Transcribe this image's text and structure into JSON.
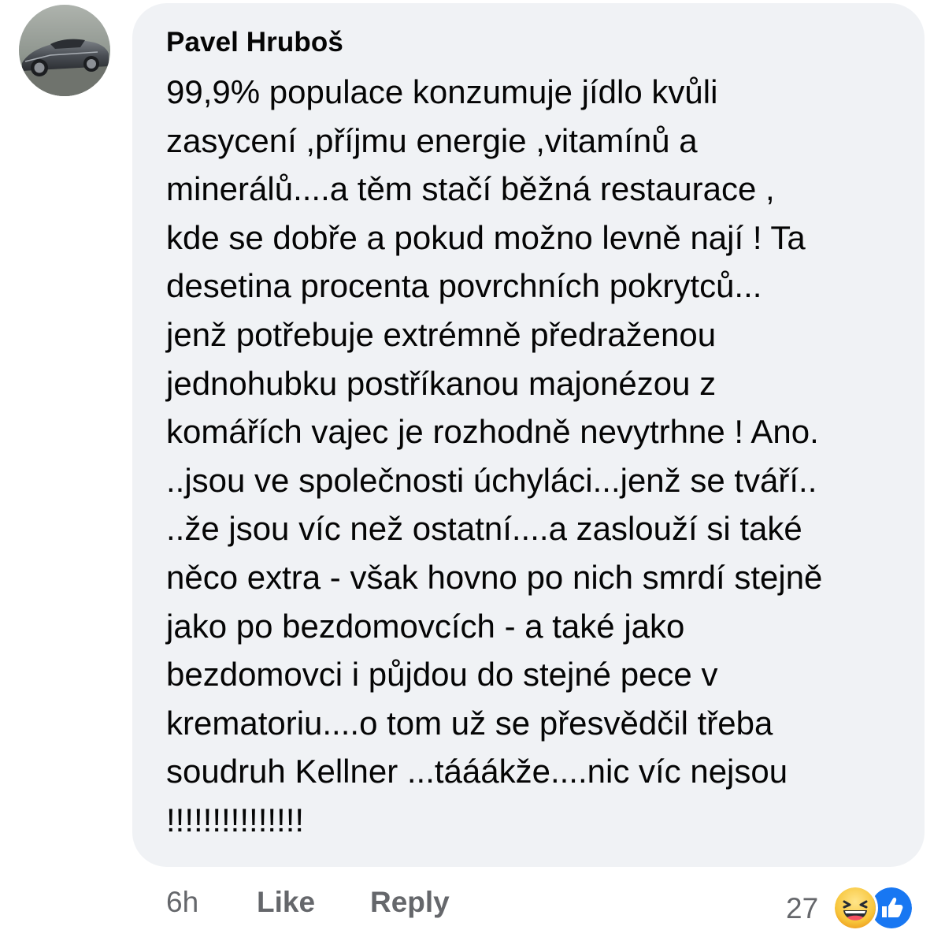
{
  "comment": {
    "author": "Pavel Hruboš",
    "text_lines": [
      "99,9% populace konzumuje jídlo kvůli",
      "zasycení ,příjmu energie ,vitamínů a",
      "minerálů....a těm stačí běžná restaurace ,",
      "kde se dobře a pokud možno levně nají ! Ta",
      "desetina procenta povrchních pokrytců...",
      "jenž potřebuje extrémně předraženou",
      "jednohubku postříkanou majonézou z",
      "komářích vajec je rozhodně nevytrhne ! Ano.",
      "..jsou ve společnosti úchyláci...jenž se tváří..",
      "..že jsou víc než ostatní....a zaslouží si také",
      "něco extra - však hovno po nich smrdí stejně",
      "jako po bezdomovcích - a také jako",
      "bezdomovci i půjdou do stejné pece v",
      "krematoriu....o tom už se přesvědčil třeba",
      "soudruh Kellner ...tááákže....nic víc nejsou",
      "!!!!!!!!!!!!!!!"
    ]
  },
  "actions": {
    "time": "6h",
    "like_label": "Like",
    "reply_label": "Reply"
  },
  "reactions": {
    "count": "27",
    "icons": [
      "haha-reaction-icon",
      "like-reaction-icon"
    ]
  },
  "colors": {
    "bubble_bg": "#f0f2f5",
    "text": "#050505",
    "secondary_text": "#65676b",
    "like_blue": "#1877f2",
    "haha_yellow": "#f7b125"
  }
}
